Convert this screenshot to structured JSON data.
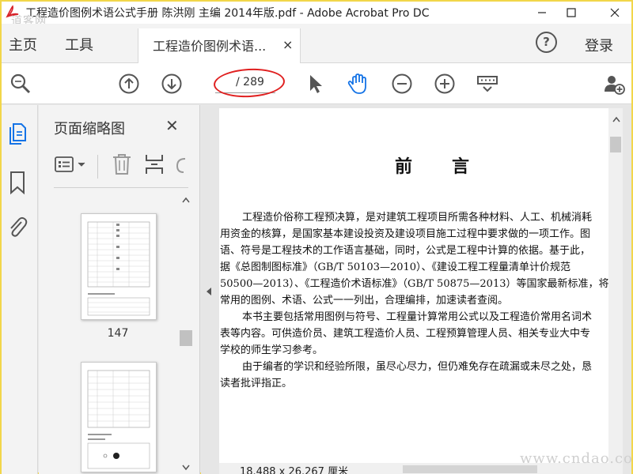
{
  "window": {
    "title": "工程造价图例术语公式手册 陈洪刚 主编 2014年版.pdf - Adobe Acrobat Pro DC",
    "watermark_top": "道客网",
    "watermark_bottom": "www.cndao.com"
  },
  "menu": {
    "home": "主页",
    "tools": "工具",
    "doc_tab": "工程造价图例术语...",
    "doc_tab_close": "×",
    "help": "?",
    "login": "登录"
  },
  "toolbar": {
    "page_current": "",
    "page_total": "/ 289",
    "icons": [
      "search-zoom-icon",
      "page-up-icon",
      "page-down-icon",
      "select-pointer-icon",
      "hand-tool-icon",
      "zoom-out-icon",
      "zoom-in-icon",
      "keyboard-icon",
      "add-user-icon"
    ]
  },
  "panel": {
    "title": "页面缩略图",
    "close": "✕",
    "thumbnails": [
      {
        "label": "147"
      },
      {
        "label": ""
      }
    ]
  },
  "document": {
    "heading": "前言",
    "paragraphs": [
      "工程造价俗称工程预决算，是对建筑工程项目所需各种材料、人工、机械消耗",
      "用资金的核算，是国家基本建设投资及建设项目施工过程中要求做的一项工作。图",
      "语、符号是工程技术的工作语言基础，同时，公式是工程中计算的依据。基于此，",
      "据《总图制图标准》（GB/T 50103—2010）、《建设工程工程量清单计价规范",
      "50500—2013）、《工程造价术语标准》（GB/T 50875—2013）等国家最新标准，将",
      "常用的图例、术语、公式一一列出，合理编排，加速读者查阅。",
      "本书主要包括常用图例与符号、工程量计算常用公式以及工程造价常用名词术",
      "表等内容。可供造价员、建筑工程造价人员、工程预算管理人员、相关专业大中专",
      "学校的师生学习参考。",
      "由于编者的学识和经验所限，虽尽心尽力，但仍难免存在疏漏或未尽之处，恳",
      "读者批评指正。"
    ],
    "page_size": "18.488 x 26.267 厘米"
  },
  "colors": {
    "accent_blue": "#1473e6",
    "annotation_red": "#e02020"
  }
}
